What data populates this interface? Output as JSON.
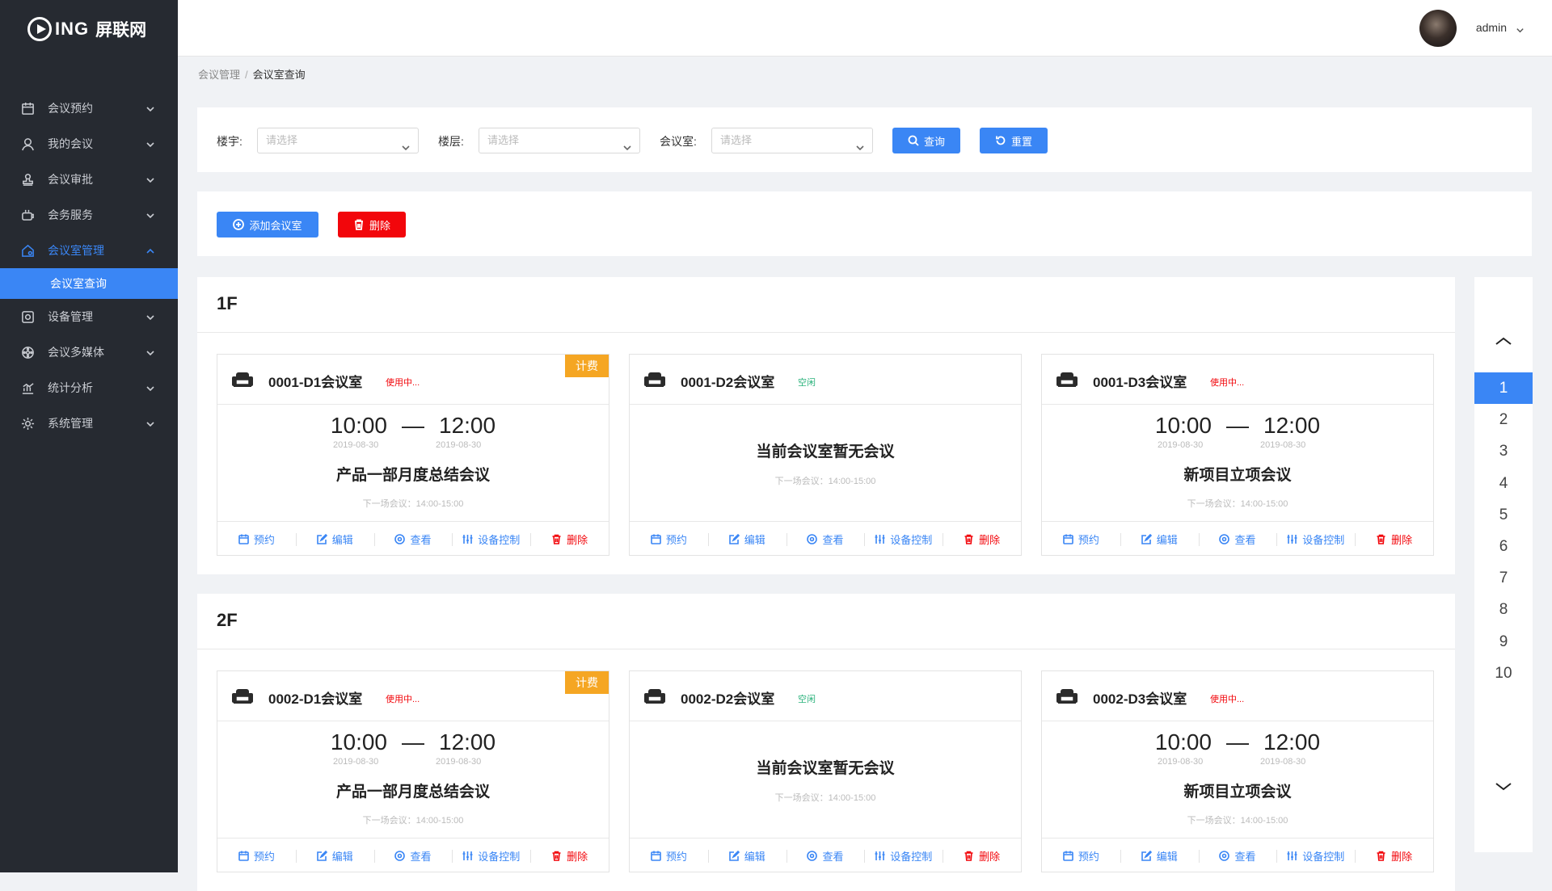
{
  "brand": {
    "mark": "ING",
    "name": "屏联网"
  },
  "sidebar": {
    "items": [
      {
        "label": "会议预约",
        "icon": "calendar-icon"
      },
      {
        "label": "我的会议",
        "icon": "user-icon"
      },
      {
        "label": "会议审批",
        "icon": "stamp-icon"
      },
      {
        "label": "会务服务",
        "icon": "service-icon"
      },
      {
        "label": "会议室管理",
        "icon": "room-manage-icon"
      },
      {
        "label": "设备管理",
        "icon": "device-icon"
      },
      {
        "label": "会议多媒体",
        "icon": "media-icon"
      },
      {
        "label": "统计分析",
        "icon": "chart-icon"
      },
      {
        "label": "系统管理",
        "icon": "settings-icon"
      }
    ],
    "active_sub": "会议室查询"
  },
  "header": {
    "user": "admin"
  },
  "breadcrumb": {
    "parent": "会议管理",
    "sep": "/",
    "current": "会议室查询"
  },
  "filters": {
    "building_label": "楼宇:",
    "building_placeholder": "请选择",
    "floor_label": "楼层:",
    "floor_placeholder": "请选择",
    "room_label": "会议室:",
    "room_placeholder": "请选择",
    "query": "查询",
    "reset": "重置"
  },
  "actions": {
    "add": "添加会议室",
    "delete": "删除"
  },
  "room_actions": {
    "book": "预约",
    "edit": "编辑",
    "view": "查看",
    "control": "设备控制",
    "delete": "删除"
  },
  "floors": [
    {
      "name": "1F",
      "rooms": [
        {
          "name": "0001-D1会议室",
          "status": "使用中...",
          "fee": "计费",
          "start": "10:00",
          "dash": "—",
          "end": "12:00",
          "start_date": "2019-08-30",
          "end_date": "2019-08-30",
          "title": "产品一部月度总结会议",
          "next": "下一场会议：14:00-15:00"
        },
        {
          "name": "0001-D2会议室",
          "status": "空闲",
          "empty": "当前会议室暂无会议",
          "next": "下一场会议：14:00-15:00"
        },
        {
          "name": "0001-D3会议室",
          "status": "使用中...",
          "start": "10:00",
          "dash": "—",
          "end": "12:00",
          "start_date": "2019-08-30",
          "end_date": "2019-08-30",
          "title": "新项目立项会议",
          "next": "下一场会议：14:00-15:00"
        }
      ]
    },
    {
      "name": "2F",
      "rooms": [
        {
          "name": "0002-D1会议室",
          "status": "使用中...",
          "fee": "计费",
          "start": "10:00",
          "dash": "—",
          "end": "12:00",
          "start_date": "2019-08-30",
          "end_date": "2019-08-30",
          "title": "产品一部月度总结会议",
          "next": "下一场会议：14:00-15:00"
        },
        {
          "name": "0002-D2会议室",
          "status": "空闲",
          "empty": "当前会议室暂无会议",
          "next": "下一场会议：14:00-15:00"
        },
        {
          "name": "0002-D3会议室",
          "status": "使用中...",
          "start": "10:00",
          "dash": "—",
          "end": "12:00",
          "start_date": "2019-08-30",
          "end_date": "2019-08-30",
          "title": "新项目立项会议",
          "next": "下一场会议：14:00-15:00"
        }
      ]
    }
  ],
  "pager": {
    "pages": [
      "1",
      "2",
      "3",
      "4",
      "5",
      "6",
      "7",
      "8",
      "9",
      "10"
    ],
    "active": "1"
  },
  "colors": {
    "primary": "#3a86f5",
    "danger": "#f2060b",
    "warning": "#f5a623",
    "success": "#2ab27b",
    "sidebar": "#262a31"
  }
}
